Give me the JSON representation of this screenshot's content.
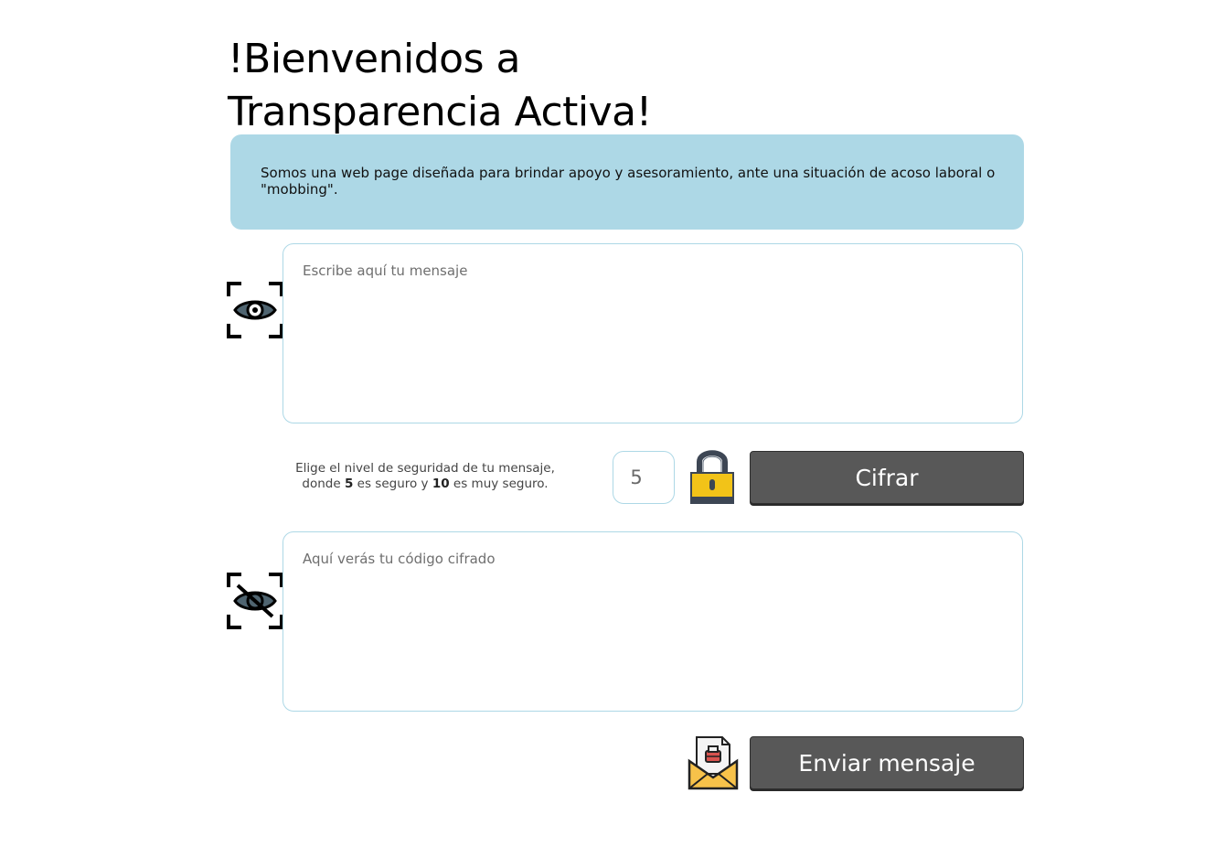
{
  "header": {
    "title_line1": "!Bienvenidos a",
    "title_line2": "Transparencia Activa!"
  },
  "intro": {
    "text": "Somos una web page diseñada para brindar apoyo y asesoramiento, ante una situación de acoso laboral o \"mobbing\"."
  },
  "message_input": {
    "placeholder": "Escribe aquí tu mensaje",
    "value": "",
    "icon": "eye-icon"
  },
  "security": {
    "hint_part1": "Elige el nivel de seguridad de tu mensaje, donde ",
    "hint_min": "5",
    "hint_part2": " es seguro y ",
    "hint_max": "10",
    "hint_part3": " es muy seguro.",
    "level_value": "5",
    "icon": "lock-icon",
    "cipher_button_label": "Cifrar"
  },
  "cipher_output": {
    "placeholder": "Aquí verás tu código cifrado",
    "value": "",
    "icon": "eye-off-icon"
  },
  "send": {
    "icon": "mail-icon",
    "button_label": "Enviar mensaje"
  },
  "colors": {
    "accent_light_blue": "#add8e6",
    "button_gray": "#585858",
    "lock_yellow": "#f2c318"
  }
}
